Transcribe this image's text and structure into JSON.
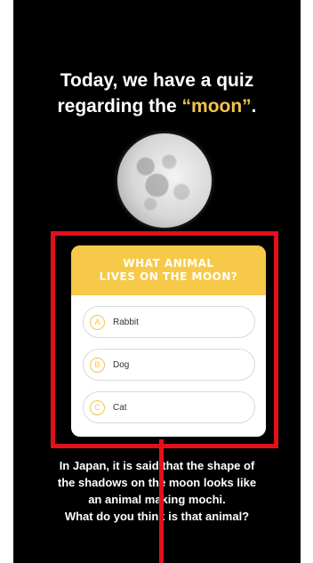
{
  "headline": {
    "line1": "Today, we have a quiz",
    "line2_prefix": "regarding the ",
    "keyword": "“moon”",
    "line2_suffix": "."
  },
  "quiz": {
    "question_line1": "WHAT ANIMAL",
    "question_line2": "LIVES ON THE MOON?",
    "options": [
      {
        "letter": "A",
        "label": "Rabbit"
      },
      {
        "letter": "B",
        "label": "Dog"
      },
      {
        "letter": "C",
        "label": "Cat"
      }
    ]
  },
  "caption": {
    "line1": "In Japan, it is said that the shape of",
    "line2": "the shadows on the moon looks like",
    "line3": "an animal making mochi.",
    "line4": "What do you think is that animal?"
  },
  "colors": {
    "background": "#000000",
    "accent_yellow": "#f7c948",
    "highlight_red": "#e3101a"
  },
  "icons": {
    "moon": "full-moon-image"
  }
}
